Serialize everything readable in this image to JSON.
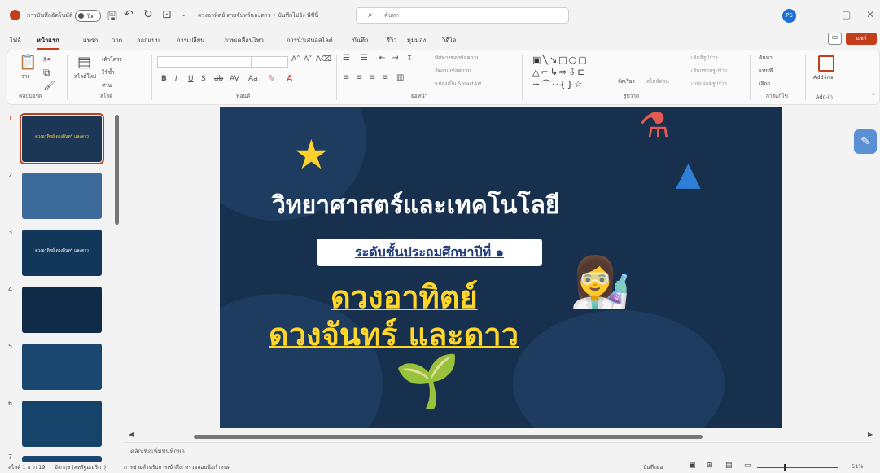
{
  "titlebar": {
    "autosave_label": "การบันทึกอัตโนมัติ",
    "autosave_state": "ปิด",
    "doc_title": "ดวงอาทิตย์ ดวงจันทร์และดาว • บันทึกไปยัง พีซีนี้",
    "search_placeholder": "ค้นหา",
    "user_initials": "PS"
  },
  "menu_tabs": [
    "ไฟล์",
    "หน้าแรก",
    "แทรก",
    "วาด",
    "ออกแบบ",
    "การเปลี่ยน",
    "ภาพเคลื่อนไหว",
    "การนำเสนอสไลด์",
    "บันทึก",
    "รีวิว",
    "มุมมอง",
    "วิดีโอ"
  ],
  "active_tab": "หน้าแรก",
  "share_label": "แชร์",
  "ribbon": {
    "groups": [
      "คลิปบอร์ด",
      "สไลด์",
      "ฟอนต์",
      "ย่อหน้า",
      "รูปวาด",
      "การแก้ไข",
      "Add-in"
    ],
    "clipboard": {
      "paste": "วาง"
    },
    "slides": {
      "new_slide": "สไลด์ใหม่",
      "layout": "เค้าโครง",
      "reuse": "ใช้ซ้ำ",
      "section": "ส่วน"
    },
    "paragraph": {
      "text_direction": "ทิศทางของข้อความ",
      "align_text": "จัดแนวข้อความ",
      "smartart": "แปลงเป็น SmartArt"
    },
    "drawing": {
      "arrange": "จัดเรียง",
      "quick_styles": "สไตล์ด่วน",
      "shape_fill": "เติมสีรูปร่าง",
      "shape_outline": "เส้นกรอบรูปร่าง",
      "shape_effects": "เอฟเฟกต์รูปร่าง"
    },
    "editing": {
      "find": "ค้นหา",
      "replace": "แทนที่",
      "select": "เลือก"
    },
    "addins": {
      "label": "Add-ins"
    }
  },
  "thumbnails": [
    {
      "num": "1",
      "text": "ดวงอาทิตย์ ดวงจันทร์ และดาว"
    },
    {
      "num": "2",
      "text": ""
    },
    {
      "num": "3",
      "text": "ดวงอาทิตย์ ดวงจันทร์ และดาว"
    },
    {
      "num": "4",
      "text": ""
    },
    {
      "num": "5",
      "text": ""
    },
    {
      "num": "6",
      "text": ""
    },
    {
      "num": "7",
      "text": ""
    }
  ],
  "slide": {
    "title": "วิทยาศาสตร์และเทคโนโลยี",
    "grade": "ระดับชั้นประถมศึกษาปีที่ ๑",
    "topic_line1": "ดวงอาทิตย์",
    "topic_line2": "ดวงจันทร์ และดาว"
  },
  "notes_hint": "คลิกเพื่อเพิ่มบันทึกย่อ",
  "statusbar": {
    "slide_count": "สไลด์ 1 จาก 19",
    "language": "อังกฤษ (สหรัฐอเมริกา)",
    "accessibility": "การช่วยสำหรับการเข้าถึง: ตรวจสอบข้อกำหนด",
    "notes": "บันทึกย่อ",
    "zoom": "51%"
  },
  "colors": {
    "accent": "#c43e1c",
    "slide_bg": "#16304d",
    "title_yellow": "#ffd629"
  }
}
